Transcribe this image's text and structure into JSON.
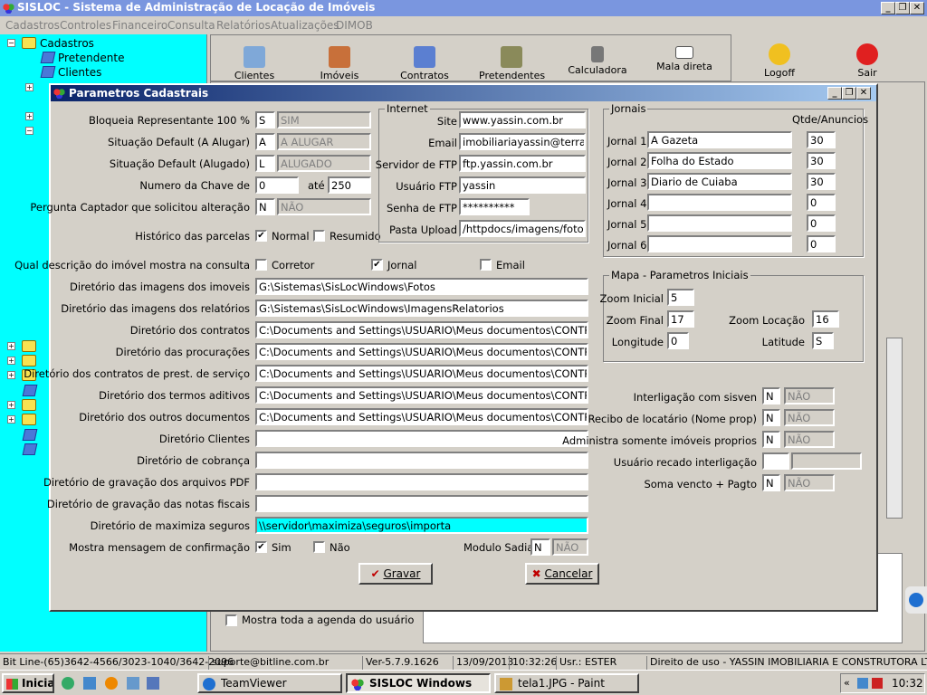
{
  "app": {
    "title": "SISLOC - Sistema de Administração de Locação de Imóveis"
  },
  "menu": [
    "Cadastros",
    "Controles",
    "Financeiro",
    "Consulta",
    "Relatórios",
    "Atualizações",
    "DIMOB"
  ],
  "tree": {
    "root": "Cadastros",
    "items": [
      "Pretendente",
      "Clientes"
    ]
  },
  "toolbar": [
    "Clientes",
    "Imóveis",
    "Contratos",
    "Pretendentes",
    "Calculadora",
    "Mala direta"
  ],
  "toolbar_right": [
    "Logoff",
    "Sair"
  ],
  "dialog": {
    "title": "Parametros Cadastrais",
    "left": {
      "bloqueia_label": "Bloqueia Representante 100 %",
      "bloqueia_code": "S",
      "bloqueia_value": "SIM",
      "sit_alugar_label": "Situação Default (A Alugar)",
      "sit_alugar_code": "A",
      "sit_alugar_value": "A ALUGAR",
      "sit_alugado_label": "Situação Default (Alugado)",
      "sit_alugado_code": "L",
      "sit_alugado_value": "ALUGADO",
      "chave_label": "Numero da Chave de",
      "chave_from": "0",
      "chave_ate": "até",
      "chave_to": "250",
      "captador_label": "Pergunta Captador que solicitou alteração",
      "captador_code": "N",
      "captador_value": "NÃO",
      "historico_label": "Histórico das parcelas",
      "normal_label": "Normal",
      "resumido_label": "Resumido",
      "descricao_label": "Qual descrição do imóvel mostra na consulta",
      "corretor_label": "Corretor",
      "jornal_label": "Jornal",
      "email_label": "Email"
    },
    "dirs": [
      {
        "label": "Diretório das imagens dos imoveis",
        "value": "G:\\Sistemas\\SisLocWindows\\Fotos"
      },
      {
        "label": "Diretório das imagens dos relatórios",
        "value": "G:\\Sistemas\\SisLocWindows\\ImagensRelatorios"
      },
      {
        "label": "Diretório dos contratos",
        "value": "C:\\Documents and Settings\\USUARIO\\Meus documentos\\CONTRATO - M"
      },
      {
        "label": "Diretório das procurações",
        "value": "C:\\Documents and Settings\\USUARIO\\Meus documentos\\CONTRATO - M"
      },
      {
        "label": "Diretório dos contratos de prest. de serviço",
        "value": "C:\\Documents and Settings\\USUARIO\\Meus documentos\\CONTRATO - M"
      },
      {
        "label": "Diretório dos termos aditivos",
        "value": "C:\\Documents and Settings\\USUARIO\\Meus documentos\\CONTRATO - M"
      },
      {
        "label": "Diretório dos outros documentos",
        "value": "C:\\Documents and Settings\\USUARIO\\Meus documentos\\CONTRATO - M"
      },
      {
        "label": "Diretório Clientes",
        "value": ""
      },
      {
        "label": "Diretório de cobrança",
        "value": ""
      },
      {
        "label": "Diretório de gravação dos arquivos PDF",
        "value": ""
      },
      {
        "label": "Diretório de gravação das notas fiscais",
        "value": ""
      },
      {
        "label": "Diretório de maximiza seguros",
        "value": "\\\\servidor\\maximiza\\seguros\\importa"
      }
    ],
    "confirm_label": "Mostra mensagem de confirmação",
    "sim_label": "Sim",
    "nao_label": "Não",
    "sadia_label": "Modulo Sadia:",
    "sadia_code": "N",
    "sadia_value": "NÃO",
    "internet": {
      "title": "Internet",
      "site_label": "Site",
      "site": "www.yassin.com.br",
      "email_label": "Email",
      "email": "imobiliariayassin@terra.com.",
      "ftp_label": "Servidor de FTP",
      "ftp": "ftp.yassin.com.br",
      "user_label": "Usuário FTP",
      "user": "yassin",
      "pwd_label": "Senha de FTP",
      "pwd": "**********",
      "upload_label": "Pasta Upload",
      "upload": "/httpdocs/imagens/fotos/lo"
    },
    "jornais": {
      "title": "Jornais",
      "qtde_label": "Qtde/Anuncios",
      "rows": [
        {
          "label": "Jornal 1",
          "name": "A Gazeta",
          "qtd": "30"
        },
        {
          "label": "Jornal 2",
          "name": "Folha do Estado",
          "qtd": "30"
        },
        {
          "label": "Jornal 3",
          "name": "Diario de Cuiaba",
          "qtd": "30"
        },
        {
          "label": "Jornal 4",
          "name": "",
          "qtd": "0"
        },
        {
          "label": "Jornal 5",
          "name": "",
          "qtd": "0"
        },
        {
          "label": "Jornal 6",
          "name": "",
          "qtd": "0"
        }
      ]
    },
    "mapa": {
      "title": "Mapa - Parametros Iniciais",
      "zoom_inicial_label": "Zoom Inicial",
      "zoom_inicial": "5",
      "zoom_final_label": "Zoom Final",
      "zoom_final": "17",
      "zoom_locacao_label": "Zoom Locação",
      "zoom_locacao": "16",
      "longitude_label": "Longitude",
      "longitude": "0",
      "latitude_label": "Latitude",
      "latitude": "S"
    },
    "right_opts": {
      "sisven_label": "Interligação com sisven",
      "sisven_code": "N",
      "sisven_value": "NÃO",
      "recibo_label": "Recibo de locatário (Nome prop)",
      "recibo_code": "N",
      "recibo_value": "NÃO",
      "proprios_label": "Administra somente imóveis proprios",
      "proprios_code": "N",
      "proprios_value": "NÃO",
      "recado_label": "Usuário recado interligação",
      "recado_code": "",
      "recado_value": "",
      "soma_label": "Soma vencto + Pagto",
      "soma_code": "N",
      "soma_value": "NÃO"
    },
    "gravar": "Gravar",
    "cancelar": "Cancelar"
  },
  "agenda_label": "Mostra toda a agenda do usuário",
  "status": {
    "phone": "Bit Line-(65)3642-4566/3023-1040/3642-2096",
    "email": "suporte@bitline.com.br",
    "version": "Ver-5.7.9.1626",
    "date": "13/09/2013",
    "time": "10:32:26",
    "user": "Usr.: ESTER",
    "rights": "Direito de uso - YASSIN IMOBILIARIA E CONSTRUTORA LTDA"
  },
  "taskbar": {
    "start": "Iniciar",
    "tasks": [
      "TeamViewer",
      "SISLOC Windows",
      "tela1.JPG - Paint"
    ],
    "clock": "10:32"
  }
}
